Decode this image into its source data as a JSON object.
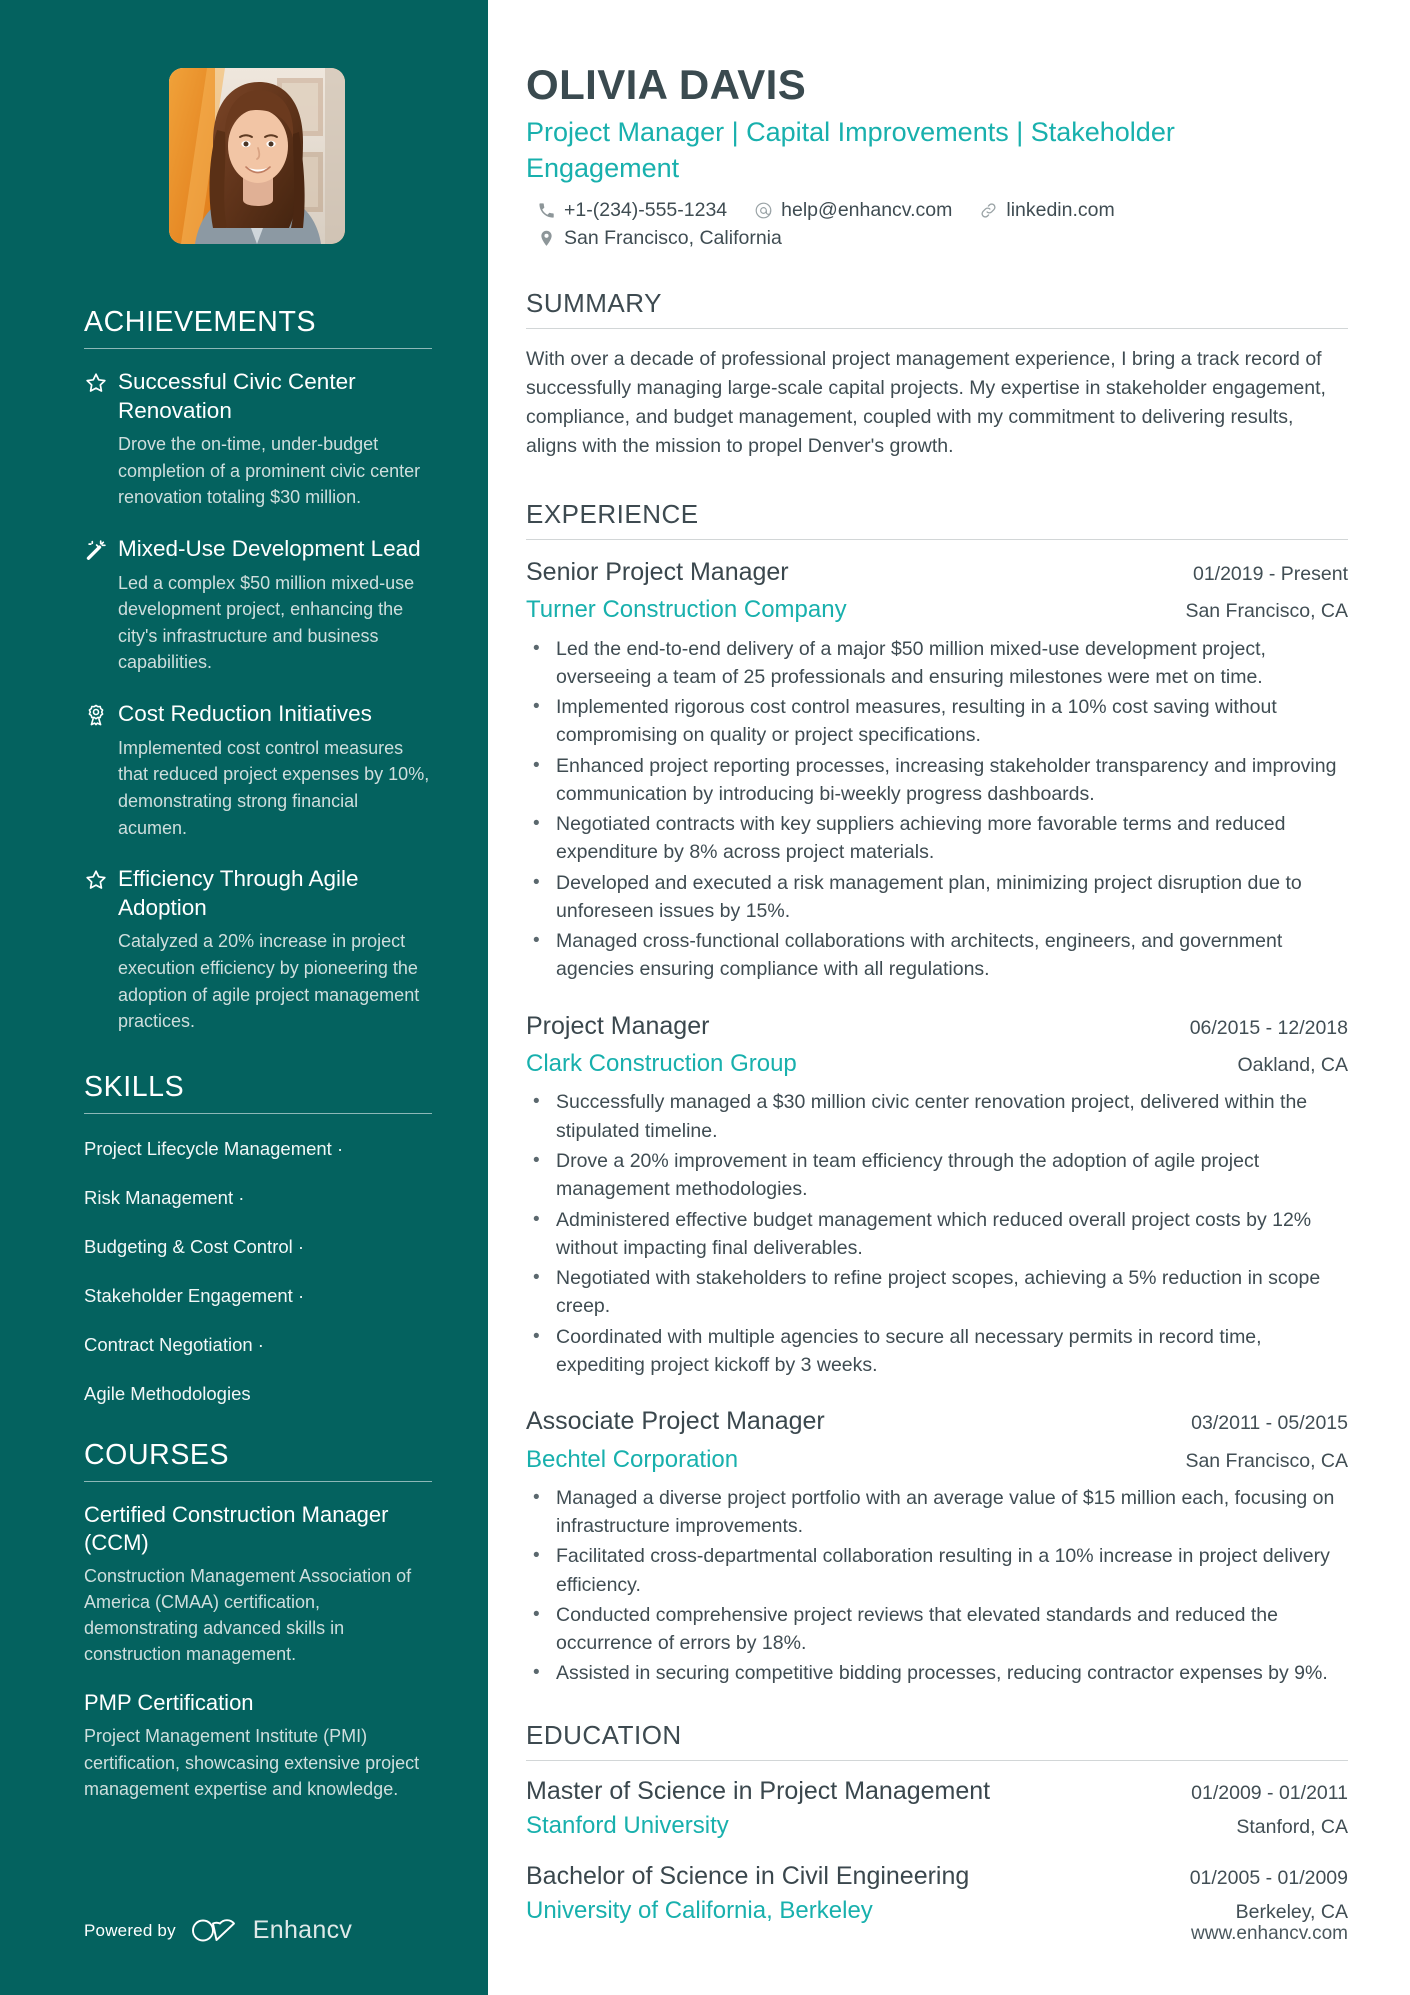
{
  "colors": {
    "sidebar_bg": "#04625f",
    "accent_teal": "#18b0ad",
    "heading_dark": "#3a4a4f",
    "body_text": "#3f4c52"
  },
  "header": {
    "name": "OLIVIA DAVIS",
    "headline": "Project Manager | Capital Improvements | Stakeholder Engagement",
    "contacts": [
      {
        "icon": "phone-icon",
        "text": "+1-(234)-555-1234"
      },
      {
        "icon": "email-icon",
        "text": "help@enhancv.com"
      },
      {
        "icon": "link-icon",
        "text": "linkedin.com"
      }
    ],
    "location": {
      "icon": "location-pin-icon",
      "text": "San Francisco, California"
    }
  },
  "summary": {
    "heading": "SUMMARY",
    "text": "With over a decade of professional project management experience, I bring a track record of successfully managing large-scale capital projects. My expertise in stakeholder engagement, compliance, and budget management, coupled with my commitment to delivering results, aligns with the mission to propel Denver's growth."
  },
  "experience": {
    "heading": "EXPERIENCE",
    "jobs": [
      {
        "title": "Senior Project Manager",
        "dates": "01/2019 - Present",
        "company": "Turner Construction Company",
        "location": "San Francisco, CA",
        "bullets": [
          "Led the end-to-end delivery of a major $50 million mixed-use development project, overseeing a team of 25 professionals and ensuring milestones were met on time.",
          "Implemented rigorous cost control measures, resulting in a 10% cost saving without compromising on quality or project specifications.",
          "Enhanced project reporting processes, increasing stakeholder transparency and improving communication by introducing bi-weekly progress dashboards.",
          "Negotiated contracts with key suppliers achieving more favorable terms and reduced expenditure by 8% across project materials.",
          "Developed and executed a risk management plan, minimizing project disruption due to unforeseen issues by 15%.",
          "Managed cross-functional collaborations with architects, engineers, and government agencies ensuring compliance with all regulations."
        ]
      },
      {
        "title": "Project Manager",
        "dates": "06/2015 - 12/2018",
        "company": "Clark Construction Group",
        "location": "Oakland, CA",
        "bullets": [
          "Successfully managed a $30 million civic center renovation project, delivered within the stipulated timeline.",
          "Drove a 20% improvement in team efficiency through the adoption of agile project management methodologies.",
          "Administered effective budget management which reduced overall project costs by 12% without impacting final deliverables.",
          "Negotiated with stakeholders to refine project scopes, achieving a 5% reduction in scope creep.",
          "Coordinated with multiple agencies to secure all necessary permits in record time, expediting project kickoff by 3 weeks."
        ]
      },
      {
        "title": "Associate Project Manager",
        "dates": "03/2011 - 05/2015",
        "company": "Bechtel Corporation",
        "location": "San Francisco, CA",
        "bullets": [
          "Managed a diverse project portfolio with an average value of $15 million each, focusing on infrastructure improvements.",
          "Facilitated cross-departmental collaboration resulting in a 10% increase in project delivery efficiency.",
          "Conducted comprehensive project reviews that elevated standards and reduced the occurrence of errors by 18%.",
          "Assisted in securing competitive bidding processes, reducing contractor expenses by 9%."
        ]
      }
    ]
  },
  "education": {
    "heading": "EDUCATION",
    "entries": [
      {
        "degree": "Master of Science in Project Management",
        "dates": "01/2009 - 01/2011",
        "school": "Stanford University",
        "location": "Stanford, CA"
      },
      {
        "degree": "Bachelor of Science in Civil Engineering",
        "dates": "01/2005 - 01/2009",
        "school": "University of California, Berkeley",
        "location": "Berkeley, CA"
      }
    ]
  },
  "achievements": {
    "heading": "ACHIEVEMENTS",
    "items": [
      {
        "icon": "star-icon",
        "title": "Successful Civic Center Renovation",
        "description": "Drove the on-time, under-budget completion of a prominent civic center renovation totaling $30 million."
      },
      {
        "icon": "magic-wand-icon",
        "title": "Mixed-Use Development Lead",
        "description": "Led a complex $50 million mixed-use development project, enhancing the city's infrastructure and business capabilities."
      },
      {
        "icon": "award-ribbon-icon",
        "title": "Cost Reduction Initiatives",
        "description": "Implemented cost control measures that reduced project expenses by 10%, demonstrating strong financial acumen."
      },
      {
        "icon": "star-icon",
        "title": "Efficiency Through Agile Adoption",
        "description": "Catalyzed a 20% increase in project execution efficiency by pioneering the adoption of agile project management practices."
      }
    ]
  },
  "skills": {
    "heading": "SKILLS",
    "items": [
      {
        "label": "Project Lifecycle Management",
        "separator": "·"
      },
      {
        "label": "Risk Management",
        "separator": "·"
      },
      {
        "label": "Budgeting & Cost Control",
        "separator": "·"
      },
      {
        "label": "Stakeholder Engagement",
        "separator": "·"
      },
      {
        "label": "Contract Negotiation",
        "separator": "·"
      },
      {
        "label": "Agile Methodologies",
        "separator": ""
      }
    ]
  },
  "courses": {
    "heading": "COURSES",
    "items": [
      {
        "title": "Certified Construction Manager (CCM)",
        "description": "Construction Management Association of America (CMAA) certification, demonstrating advanced skills in construction management."
      },
      {
        "title": "PMP Certification",
        "description": "Project Management Institute (PMI) certification, showcasing extensive project management expertise and knowledge."
      }
    ]
  },
  "footer": {
    "powered_by": "Powered by",
    "brand": "Enhancv",
    "website": "www.enhancv.com"
  }
}
